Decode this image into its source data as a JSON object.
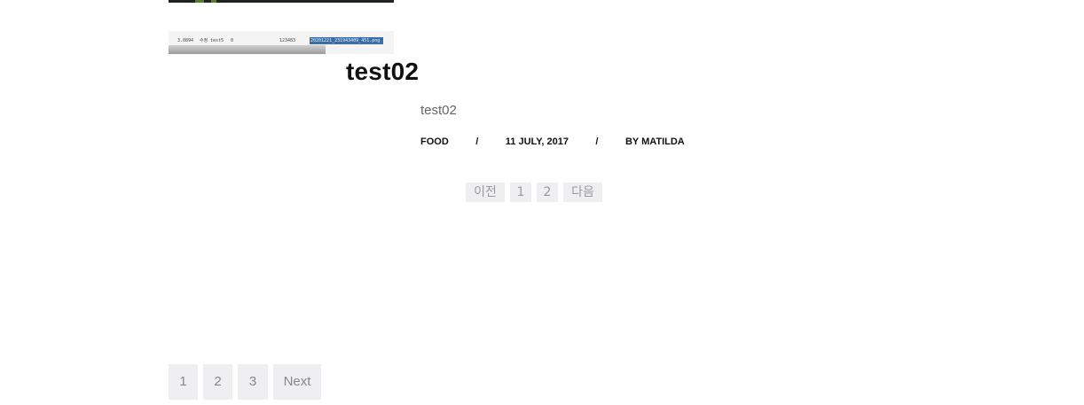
{
  "post": {
    "title": "test02",
    "excerpt": "test02",
    "category": "FOOD",
    "date": "11 JULY, 2017",
    "author": "BY MATILDA",
    "meta_separator": "/"
  },
  "thumbnail": {
    "col1": "3.0894",
    "col2": "수정",
    "col3": "test5",
    "col4": "0",
    "col5": "123483",
    "selected": "20201221_231943409_451.png"
  },
  "post_pagination": {
    "prev_label": "이전",
    "pages": [
      "1",
      "2"
    ],
    "next_label": "다음"
  },
  "pagination": {
    "pages": [
      "1",
      "2",
      "3"
    ],
    "next_label": "Next"
  }
}
